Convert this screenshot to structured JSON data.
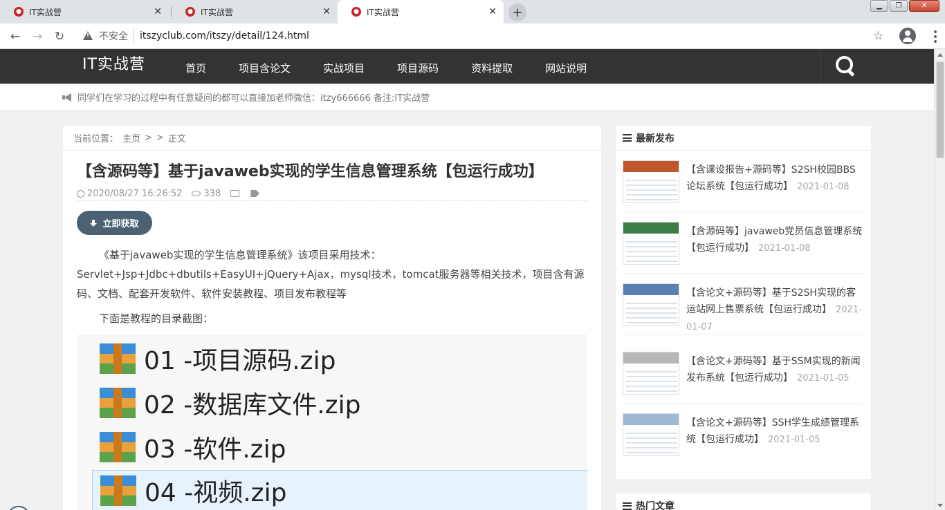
{
  "browser": {
    "tabs": [
      {
        "title": "IT实战营",
        "active": false
      },
      {
        "title": "IT实战营",
        "active": false
      },
      {
        "title": "IT实战营",
        "active": true
      }
    ],
    "insecure_label": "不安全",
    "url": "itszyclub.com/itszy/detail/124.html"
  },
  "site": {
    "logo": "IT实战营",
    "nav": [
      "首页",
      "项目含论文",
      "实战项目",
      "项目源码",
      "资料提取",
      "网站说明"
    ],
    "notice": "同学们在学习的过程中有任意疑问的都可以直接加老师微信：itzy666666 备注:IT实战营"
  },
  "article": {
    "breadcrumb": {
      "label": "当前位置：",
      "home": "主页",
      "sep1": ">",
      "sep2": ">",
      "current": "正文"
    },
    "title": "【含源码等】基于javaweb实现的学生信息管理系统【包运行成功】",
    "datetime": "2020/08/27 16:26:52",
    "views": "338",
    "download_label": "立即获取",
    "para1": "《基于javaweb实现的学生信息管理系统》该项目采用技术：Servlet+Jsp+Jdbc+dbutils+EasyUI+jQuery+Ajax，mysql技术，tomcat服务器等相关技术，项目含有源码、文档、配套开发软件、软件安装教程、项目发布教程等",
    "para2": "下面是教程的目录截图：",
    "files": [
      "01 -项目源码.zip",
      "02 -数据库文件.zip",
      "03 -软件.zip",
      "04 -视频.zip"
    ]
  },
  "sidebar": {
    "latest_title": "最新发布",
    "posts": [
      {
        "title": "【含课设报告+源码等】S2SH校园BBS论坛系统【包运行成功】",
        "date": "2021-01-08",
        "thumb_color": "#c0562b"
      },
      {
        "title": "【含源码等】javaweb党员信息管理系统【包运行成功】",
        "date": "2021-01-08",
        "thumb_color": "#3b7e4a"
      },
      {
        "title": "【含论文+源码等】基于S2SH实现的客运站网上售票系统【包运行成功】",
        "date": "2021-01-07",
        "thumb_color": "#5a7fb0"
      },
      {
        "title": "【含论文+源码等】基于SSM实现的新闻发布系统【包运行成功】",
        "date": "2021-01-05",
        "thumb_color": "#b7b7b7"
      },
      {
        "title": "【含论文+源码等】SSH学生成绩管理系统【包运行成功】",
        "date": "2021-01-05",
        "thumb_color": "#9fb8d6"
      }
    ],
    "hot_title": "热门文章"
  }
}
